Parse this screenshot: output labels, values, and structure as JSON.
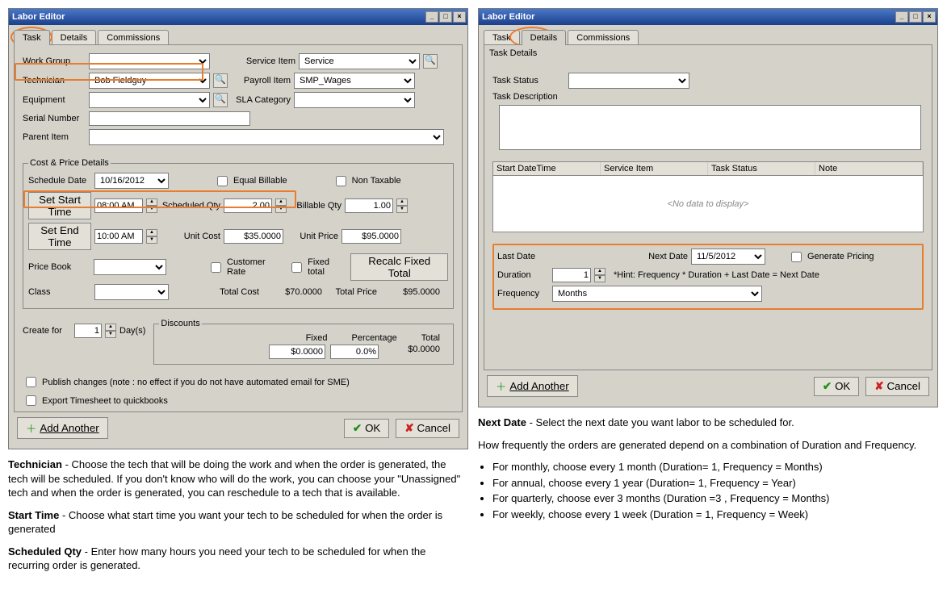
{
  "left": {
    "title": "Labor Editor",
    "tabs": [
      "Task",
      "Details",
      "Commissions"
    ],
    "activeTab": "Task",
    "labels": {
      "workGroup": "Work Group",
      "technician": "Technician",
      "equipment": "Equipment",
      "serialNumber": "Serial Number",
      "parentItem": "Parent Item",
      "serviceItem": "Service Item",
      "payrollItem": "Payroll Item",
      "slaCategory": "SLA Category",
      "costPrice": "Cost & Price Details",
      "scheduleDate": "Schedule Date",
      "equalBillable": "Equal Billable",
      "nonTaxable": "Non Taxable",
      "setStartTime": "Set Start Time",
      "scheduledQty": "Scheduled Qty",
      "billableQty": "Billable Qty",
      "setEndTime": "Set End Time",
      "unitCost": "Unit Cost",
      "unitPrice": "Unit Price",
      "priceBook": "Price Book",
      "customerRate": "Customer Rate",
      "fixedTotal": "Fixed total",
      "recalcFixed": "Recalc Fixed Total",
      "class": "Class",
      "totalCost": "Total Cost",
      "totalPrice": "Total Price",
      "createFor": "Create for",
      "days": "Day(s)",
      "discounts": "Discounts",
      "fixed": "Fixed",
      "percentage": "Percentage",
      "total": "Total",
      "publish": "Publish changes (note : no effect if you do not have automated email for SME)",
      "export": "Export Timesheet to quickbooks",
      "addAnother": "Add Another",
      "ok": "OK",
      "cancel": "Cancel"
    },
    "values": {
      "technician": "Bob Fieldguy",
      "serviceItem": "Service",
      "payrollItem": "SMP_Wages",
      "scheduleDate": "10/16/2012",
      "startTime": "08:00 AM",
      "endTime": "10:00 AM",
      "scheduledQty": "2.00",
      "billableQty": "1.00",
      "unitCost": "$35.0000",
      "unitPrice": "$95.0000",
      "totalCost": "$70.0000",
      "totalPrice": "$95.0000",
      "createFor": "1",
      "discFixed": "$0.0000",
      "discPct": "0.0%",
      "discTotal": "$0.0000"
    }
  },
  "right": {
    "title": "Labor Editor",
    "tabs": [
      "Task",
      "Details",
      "Commissions"
    ],
    "activeTab": "Details",
    "sectionLabel": "Task Details",
    "labels": {
      "taskStatus": "Task Status",
      "taskDescription": "Task Description",
      "gridCols": [
        "Start DateTime",
        "Service Item",
        "Task Status",
        "Note"
      ],
      "noData": "<No data to display>",
      "lastDate": "Last Date",
      "nextDate": "Next Date",
      "generatePricing": "Generate Pricing",
      "duration": "Duration",
      "hint": "*Hint: Frequency * Duration + Last Date = Next Date",
      "frequency": "Frequency",
      "addAnother": "Add Another",
      "ok": "OK",
      "cancel": "Cancel"
    },
    "values": {
      "nextDate": "11/5/2012",
      "duration": "1",
      "frequency": "Months"
    }
  },
  "descLeft": {
    "tech": "Technician",
    "techText": " - Choose the tech that will be doing the work and when the order is generated, the tech will be scheduled. If you don't know who will do the work, you can choose your \"Unassigned\" tech and when the order is generated, you can reschedule to a tech that is available.",
    "start": "Start Time",
    "startText": " - Choose what start time you want your tech to be scheduled for when the order is generated",
    "qty": "Scheduled Qty",
    "qtyText": " - Enter how many hours you need your tech to be scheduled for when the recurring order is generated."
  },
  "descRight": {
    "next": "Next Date",
    "nextText": " - Select the next date you want labor to be scheduled for.",
    "freqIntro": "How frequently the orders are generated depend on a combination of Duration and Frequency.",
    "b1": "For monthly, choose every 1 month (Duration= 1, Frequency = Months)",
    "b2": "For annual, choose every 1 year (Duration= 1, Frequency = Year)",
    "b3": "For quarterly, choose ever 3 months (Duration =3 , Frequency = Months)",
    "b4": "For weekly, choose every 1 week (Duration = 1, Frequency = Week)"
  }
}
